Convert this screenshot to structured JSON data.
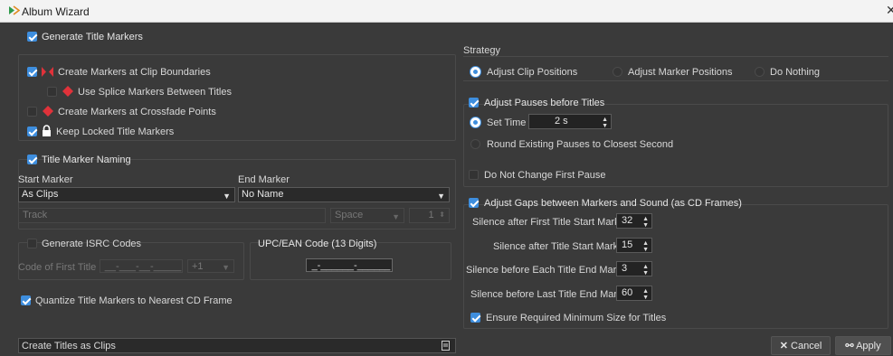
{
  "window": {
    "title": "Album Wizard",
    "close_glyph": "✕"
  },
  "left": {
    "generate_title_markers": "Generate Title Markers",
    "create_markers_clip_boundaries": "Create Markers at Clip Boundaries",
    "use_splice_markers": "Use Splice Markers Between Titles",
    "create_markers_crossfade": "Create Markers at Crossfade Points",
    "keep_locked": "Keep Locked Title Markers",
    "title_marker_naming": "Title Marker Naming",
    "start_marker_label": "Start Marker",
    "end_marker_label": "End Marker",
    "start_marker_value": "As Clips",
    "end_marker_value": "No Name",
    "name_field_value": "Track",
    "separator_value": "Space",
    "number_value": "1",
    "generate_isrc": "Generate ISRC Codes",
    "code_of_first_title_label": "Code of First Title",
    "isrc_value": "__-___-__-_____",
    "isrc_increment": "+1",
    "upc_label": "UPC/EAN Code (13 Digits)",
    "upc_value": "_-______-______",
    "quantize": "Quantize Title Markers to Nearest CD Frame",
    "bottom_select_value": "Create Titles as Clips"
  },
  "right": {
    "strategy_label": "Strategy",
    "strategy_options": [
      "Adjust Clip Positions",
      "Adjust Marker Positions",
      "Do Nothing"
    ],
    "adjust_pauses": "Adjust Pauses before Titles",
    "set_time": "Set Time",
    "set_time_value": "2 s",
    "round_pauses": "Round Existing Pauses to Closest Second",
    "do_not_change": "Do Not Change First Pause",
    "adjust_gaps": "Adjust Gaps between Markers and Sound (as CD Frames)",
    "silence_rows": [
      {
        "label": "Silence after First Title Start Marker",
        "value": "32"
      },
      {
        "label": "Silence after Title Start Marker",
        "value": "15"
      },
      {
        "label": "Silence before Each Title End Marker",
        "value": "3"
      },
      {
        "label": "Silence before Last Title End Marker",
        "value": "60"
      }
    ],
    "ensure_minimum": "Ensure Required Minimum Size for Titles"
  },
  "buttons": {
    "cancel": "Cancel",
    "apply": "Apply"
  },
  "colors": {
    "accent": "#3e8ede",
    "marker_red": "#e0323a",
    "background": "#3a3a3a"
  },
  "icons": {
    "app": "album-wizard-logo-icon",
    "clip_boundary": "clip-boundary-marker-icon",
    "splice": "splice-marker-icon",
    "crossfade": "crossfade-marker-icon",
    "lock": "lock-icon",
    "cancel": "close-icon",
    "apply": "link-icon",
    "bottom_select": "document-icon"
  }
}
